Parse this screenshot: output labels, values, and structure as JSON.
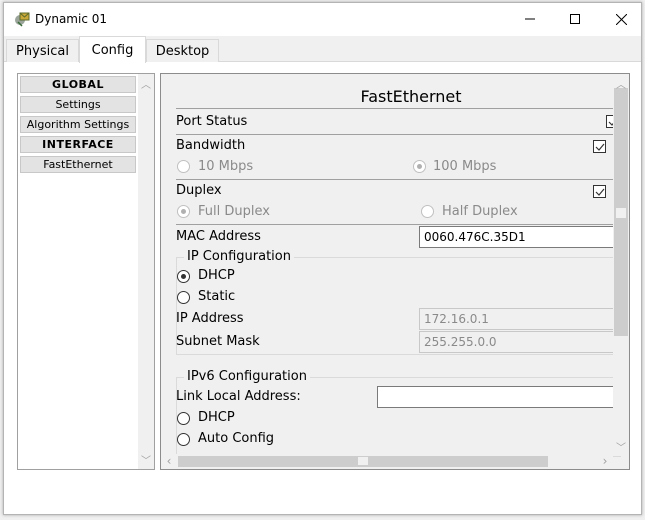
{
  "window": {
    "title": "Dynamic 01",
    "controls": {
      "minimize": "—",
      "maximize": "☐",
      "close": "✕"
    }
  },
  "tabs": [
    {
      "label": "Physical",
      "active": false
    },
    {
      "label": "Config",
      "active": true
    },
    {
      "label": "Desktop",
      "active": false
    }
  ],
  "sidebar": {
    "items": [
      {
        "label": "GLOBAL",
        "type": "header"
      },
      {
        "label": "Settings",
        "type": "item"
      },
      {
        "label": "Algorithm Settings",
        "type": "item"
      },
      {
        "label": "INTERFACE",
        "type": "header"
      },
      {
        "label": "FastEthernet",
        "type": "item"
      }
    ]
  },
  "panel": {
    "title": "FastEthernet",
    "port_status": {
      "label": "Port Status",
      "checked": true
    },
    "bandwidth": {
      "label": "Bandwidth",
      "auto_checked": true,
      "options": [
        {
          "label": "10 Mbps",
          "selected": false,
          "disabled": true
        },
        {
          "label": "100 Mbps",
          "selected": true,
          "disabled": true
        }
      ]
    },
    "duplex": {
      "label": "Duplex",
      "auto_checked": true,
      "options": [
        {
          "label": "Full Duplex",
          "selected": true,
          "disabled": true
        },
        {
          "label": "Half Duplex",
          "selected": false,
          "disabled": true
        }
      ]
    },
    "mac": {
      "label": "MAC Address",
      "value": "0060.476C.35D1"
    },
    "ip_config": {
      "title": "IP Configuration",
      "dhcp_label": "DHCP",
      "static_label": "Static",
      "mode": "DHCP",
      "ip_label": "IP Address",
      "ip_value": "172.16.0.1",
      "mask_label": "Subnet Mask",
      "mask_value": "255.255.0.0"
    },
    "ipv6_config": {
      "title": "IPv6 Configuration",
      "link_local_label": "Link Local Address:",
      "link_local_value": "",
      "dhcp_label": "DHCP",
      "auto_label": "Auto Config"
    }
  },
  "colors": {
    "panel_bg": "#f0f0f0",
    "disabled_text": "#8a8a8a",
    "nav_bg": "#e3e3e3"
  }
}
